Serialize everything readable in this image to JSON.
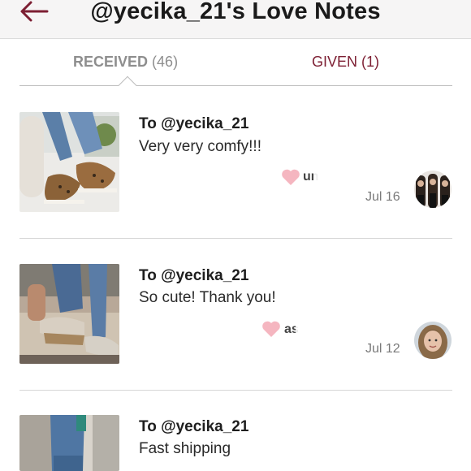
{
  "header": {
    "title": "@yecika_21's Love Notes"
  },
  "tabs": {
    "received_label": "RECEIVED",
    "received_count": "(46)",
    "given_label": "GIVEN",
    "given_count": "(1)"
  },
  "notes": [
    {
      "to": "To @yecika_21",
      "message": "Very very comfy!!!",
      "user": "un",
      "date": "Jul 16"
    },
    {
      "to": "To @yecika_21",
      "message": "So cute! Thank you!",
      "user": "as",
      "date": "Jul 12"
    },
    {
      "to": "To @yecika_21",
      "message": "Fast shipping"
    }
  ],
  "colors": {
    "accent": "#7d1f33",
    "heart": "#f5b6c0",
    "tab_inactive": "#8e8e8e"
  },
  "icons": {
    "back": "arrow-left-icon",
    "heart": "heart-icon"
  }
}
